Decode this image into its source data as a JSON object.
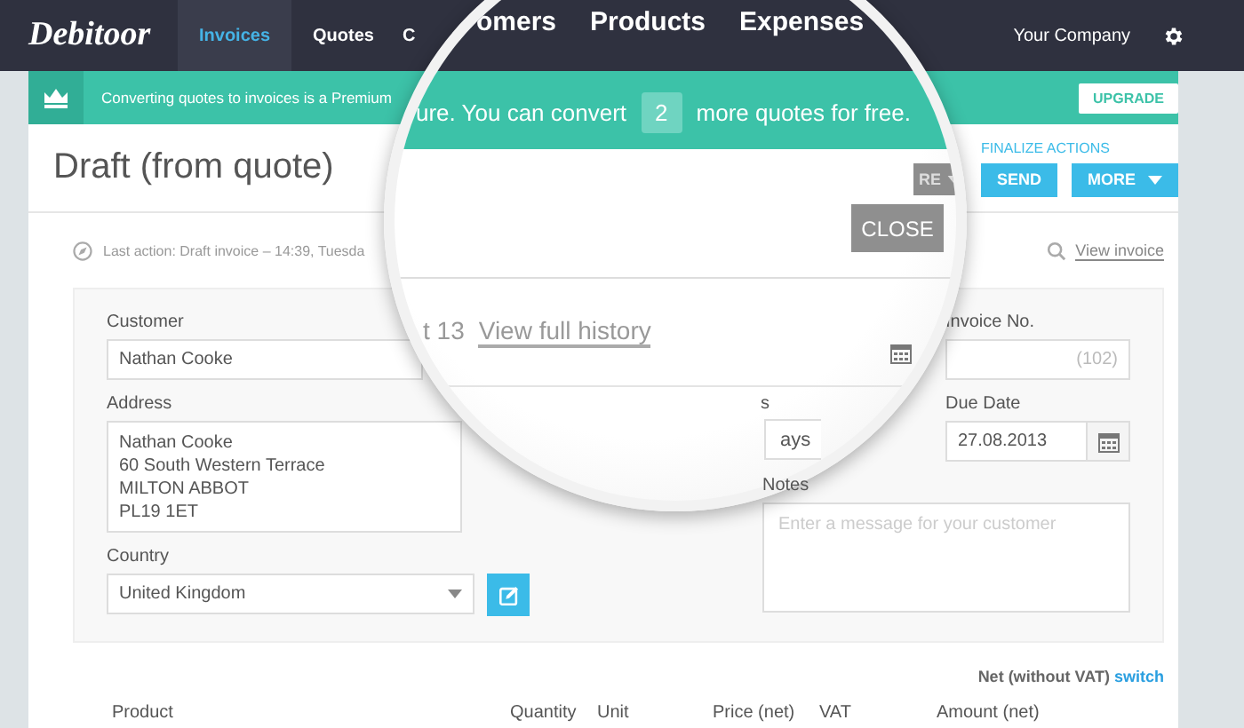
{
  "nav": {
    "logo": "Debitoor",
    "tabs": [
      {
        "label": "Invoices",
        "selected": true
      },
      {
        "label": "Quotes",
        "selected": false
      },
      {
        "label": "C",
        "selected": false
      }
    ],
    "account": "Your Company"
  },
  "banner": {
    "text": "Converting quotes to invoices is a Premium",
    "button": "UPGRADE"
  },
  "header": {
    "title": "Draft (from quote)",
    "finalize_label": "FINALIZE ACTIONS",
    "buttons": [
      {
        "label": "SEND",
        "dropdown": false
      },
      {
        "label": "MORE",
        "dropdown": true
      }
    ]
  },
  "last_action": "Last action: Draft invoice – 14:39, Tuesda",
  "view_invoice": "View invoice",
  "form": {
    "customer_label": "Customer",
    "customer": "Nathan Cooke",
    "address_label": "Address",
    "address": [
      "Nathan Cooke",
      "60 South Western Terrace",
      "MILTON ABBOT",
      "PL19 1ET"
    ],
    "country_label": "Country",
    "country": "United Kingdom",
    "invoice_no_label": "Invoice No.",
    "invoice_no_placeholder": "(102)",
    "due_date_label": "Due Date",
    "due_date": "27.08.2013",
    "notes_label": "Notes",
    "notes_placeholder": "Enter a message for your customer"
  },
  "price_mode": {
    "label": "Net (without VAT)",
    "link": "switch"
  },
  "table": {
    "columns": [
      "Product",
      "Quantity",
      "Unit",
      "Price (net)",
      "VAT",
      "Amount (net)"
    ]
  },
  "magnifier": {
    "nav_items": [
      "omers",
      "Products",
      "Expenses"
    ],
    "banner_before": "ure. You can convert",
    "count": "2",
    "banner_after": "more quotes for free.",
    "partial_button": "RE",
    "close_button": "CLOSE",
    "history_prefix": "t 13",
    "history_link": "View full history",
    "terms_label": "s",
    "terms_value": "ays"
  }
}
